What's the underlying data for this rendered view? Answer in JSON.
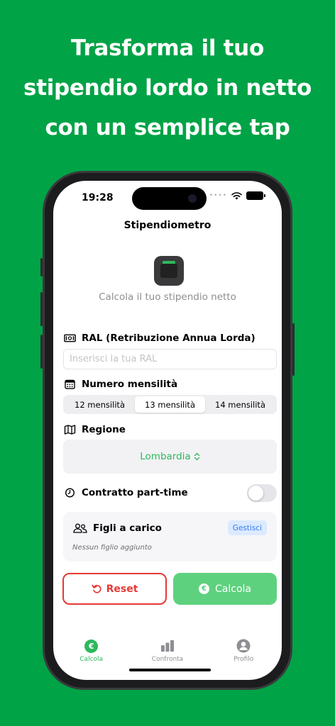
{
  "headline": {
    "line1": "Trasforma il tuo",
    "line2": "stipendio lordo in netto",
    "line3": "con un semplice tap"
  },
  "status_bar": {
    "time": "19:28"
  },
  "nav": {
    "title": "Stipendiometro"
  },
  "hero": {
    "icon": "money-envelope-icon",
    "subtitle": "Calcola il tuo stipendio netto"
  },
  "ral": {
    "icon": "banknote-icon",
    "label": "RAL (Retribuzione Annua Lorda)",
    "value": "",
    "placeholder": "Inserisci la tua RAL"
  },
  "mensilita": {
    "icon": "calendar-icon",
    "label": "Numero mensilità",
    "options": [
      "12 mensilità",
      "13 mensilità",
      "14 mensilità"
    ],
    "selected": "13 mensilità"
  },
  "regione": {
    "icon": "map-icon",
    "label": "Regione",
    "value": "Lombardia",
    "chevron": "⌃⌄"
  },
  "part_time": {
    "icon": "clock-icon",
    "label": "Contratto part-time",
    "enabled": false
  },
  "figli": {
    "icon": "people-icon",
    "label": "Figli a carico",
    "manage_label": "Gestisci",
    "empty_text": "Nessun figlio aggiunto"
  },
  "actions": {
    "reset_label": "Reset",
    "calc_label": "Calcola",
    "calc_icon_glyph": "€"
  },
  "tabbar": {
    "items": [
      {
        "label": "Calcola",
        "icon": "euro-icon",
        "active": true
      },
      {
        "label": "Confronta",
        "icon": "bar-chart-icon",
        "active": false
      },
      {
        "label": "Profilo",
        "icon": "person-icon",
        "active": false
      }
    ]
  },
  "colors": {
    "background": "#00a346",
    "accent": "#2eb85c",
    "danger": "#e53935",
    "info": "#2f7cf6"
  }
}
